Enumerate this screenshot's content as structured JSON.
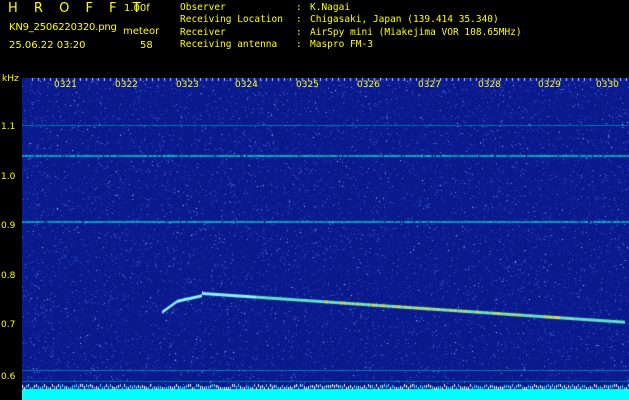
{
  "header": {
    "brand": "H R O F F T",
    "version": "1.00f",
    "filename": "KN9_2506220320.png",
    "meteor_label": "meteor",
    "datetime": "25.06.22 03:20",
    "meteor_count": "58"
  },
  "info": [
    {
      "key": "Observer",
      "sep": ":",
      "value": "K.Nagai"
    },
    {
      "key": "Receiving Location",
      "sep": ":",
      "value": "Chigasaki, Japan (139.414 35.340)"
    },
    {
      "key": "Receiver",
      "sep": ":",
      "value": "AirSpy mini (Miakejima VOR 108.65MHz)"
    },
    {
      "key": "Receiving antenna",
      "sep": ":",
      "value": "Maspro FM-3"
    }
  ],
  "plot": {
    "unit": "kHz",
    "y_ticks": [
      "1.1",
      "1.0",
      "0.9",
      "0.8",
      "0.7",
      "0.6"
    ],
    "time_ticks": [
      "0321",
      "0322",
      "0323",
      "0324",
      "0325",
      "0326",
      "0327",
      "0328",
      "0329",
      "0330"
    ],
    "colors": {
      "background": "#0a1a8c",
      "noise": "#2a4ad8",
      "carrier": "#00e0d8",
      "meteor_trail": "#e0e040",
      "axis_label": "#ffff00",
      "bottom_band": "#00ffff"
    }
  }
}
